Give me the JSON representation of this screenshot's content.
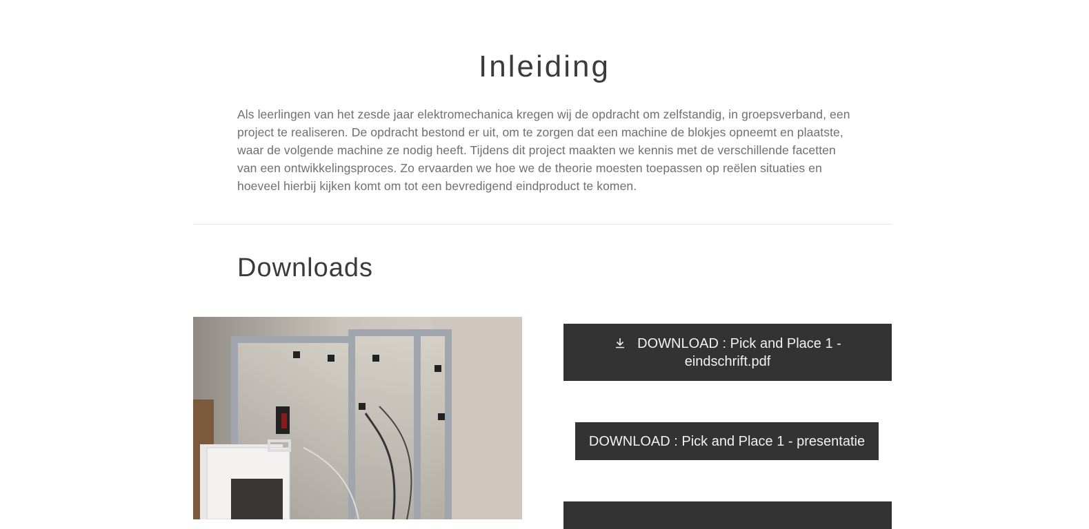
{
  "intro": {
    "title": "Inleiding",
    "text": "Als leerlingen van het zesde jaar elektromechanica kregen wij de opdracht om zelfstandig, in groepsverband, een project te realiseren. De opdracht bestond er uit, om te zorgen dat een machine de blokjes opneemt en plaatste, waar de volgende machine ze nodig heeft. Tijdens dit project maakten we kennis met de verschillende facetten van een ontwikkelingsproces. Zo ervaarden we hoe we de theorie moesten toepassen op reëlen situaties en hoeveel hierbij kijken komt om tot een bevredigend eindproduct te komen."
  },
  "downloads": {
    "title": "Downloads",
    "buttons": [
      {
        "label": "DOWNLOAD : Pick and Place 1 - eindschrift.pdf",
        "icon": "download-icon"
      },
      {
        "label": "DOWNLOAD : Pick and Place 1 - presentatie"
      },
      {
        "label": ""
      }
    ]
  },
  "colors": {
    "button_bg": "#333333",
    "button_text": "#f2f2f2",
    "heading": "#3b3b3b",
    "body_text": "#6f6f6f"
  }
}
